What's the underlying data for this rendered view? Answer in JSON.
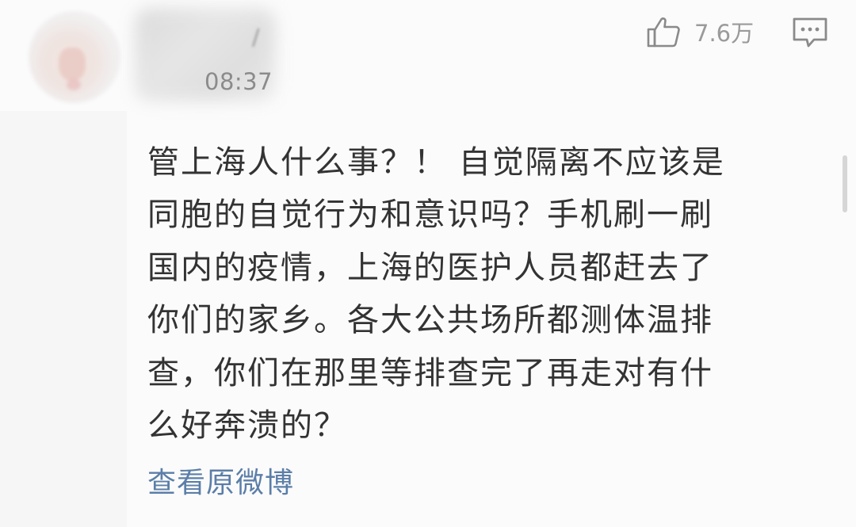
{
  "post": {
    "username_partial": "/",
    "time": "08:37",
    "likes": "7.6万",
    "comment_lines": [
      "管上海人什么事？！ 自觉隔离不应该是",
      "同胞的自觉行为和意识吗？手机刷一刷",
      "国内的疫情，上海的医护人员都赶去了",
      "你们的家乡。各大公共场所都测体温排",
      "查，你们在那里等排查完了再走对有什",
      "么好奔溃的？"
    ],
    "view_original_link": "查看原微博"
  },
  "colors": {
    "link": "#5b7ea8",
    "text": "#333333",
    "meta": "#8b8b8b",
    "icon": "#8a8a8a"
  },
  "icons": {
    "like": "thumbs-up-icon",
    "reply": "comment-bubble-icon"
  }
}
